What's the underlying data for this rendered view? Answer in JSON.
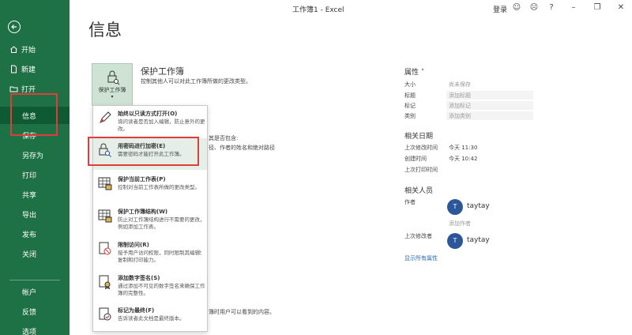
{
  "window": {
    "title": "工作簿1 - Excel",
    "login": "登录",
    "icons": [
      "smiley-icon",
      "frown-icon",
      "help-icon",
      "minimize-icon",
      "restore-icon",
      "close-icon"
    ]
  },
  "sidebar": {
    "items": [
      {
        "label": "开始",
        "icon": "home-icon"
      },
      {
        "label": "新建",
        "icon": "new-doc-icon"
      },
      {
        "label": "打开",
        "icon": "folder-open-icon"
      },
      {
        "label": "信息"
      },
      {
        "label": "保存"
      },
      {
        "label": "另存为"
      },
      {
        "label": "打印"
      },
      {
        "label": "共享"
      },
      {
        "label": "导出"
      },
      {
        "label": "发布"
      },
      {
        "label": "关闭"
      },
      {
        "label": "帐户"
      },
      {
        "label": "反馈"
      },
      {
        "label": "选项"
      }
    ]
  },
  "main": {
    "page_title": "信息",
    "protect": {
      "button_label": "保护工作簿",
      "title": "保护工作簿",
      "description": "控制其他人可以对此工作簿所做的更改类型。"
    },
    "bg_text": {
      "check1": "其是否包含:",
      "check2": "径、作者的姓名和绝对路径",
      "versions": "簿时用户可以看到的内容。"
    }
  },
  "menu": {
    "items": [
      {
        "title": "始终以只读方式打开(O)",
        "desc": "询问读者是否加入编辑，防止意外的更改。",
        "icon": "pencil-icon"
      },
      {
        "title": "用密码进行加密(E)",
        "desc": "需要密码才能打开此工作簿。",
        "icon": "lock-search-icon"
      },
      {
        "title": "保护当前工作表(P)",
        "desc": "控制对当前工作表所做的更改类型。",
        "icon": "sheet-lock-icon"
      },
      {
        "title": "保护工作簿结构(W)",
        "desc": "防止对工作簿结构进行不需要的更改，例如添加工作表。",
        "icon": "workbook-lock-icon"
      },
      {
        "title": "限制访问(R)",
        "desc": "授予用户访问权限，同时限制其编辑、复制和打印能力。",
        "icon": "restrict-icon"
      },
      {
        "title": "添加数字签名(S)",
        "desc": "通过添加不可见的数字签名来确保工作簿的完整性。",
        "icon": "signature-icon"
      },
      {
        "title": "标记为最终(F)",
        "desc": "告诉读者此文档是最终版本。",
        "icon": "final-icon"
      }
    ],
    "submenu_arrow": "›"
  },
  "properties": {
    "heading": "属性 ˅",
    "rows": [
      {
        "label": "大小",
        "value": "尚未保存"
      },
      {
        "label": "标题",
        "value": "添加标题"
      },
      {
        "label": "标记",
        "value": "添加标记"
      },
      {
        "label": "类别",
        "value": "添加类别"
      }
    ],
    "dates_heading": "相关日期",
    "dates": [
      {
        "label": "上次修改时间",
        "value": "今天 11:30"
      },
      {
        "label": "创建时间",
        "value": "今天 10:42"
      },
      {
        "label": "上次打印时间",
        "value": ""
      }
    ],
    "people_heading": "相关人员",
    "author_label": "作者",
    "author_name": "taytay",
    "author_initial": "T",
    "add_author": "添加作者",
    "modifier_label": "上次修改者",
    "modifier_name": "taytay",
    "modifier_initial": "T",
    "show_all": "显示所有属性"
  }
}
